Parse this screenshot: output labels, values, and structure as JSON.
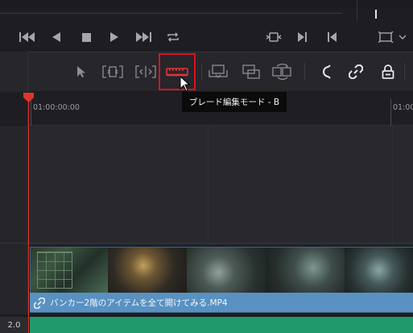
{
  "toolbar": {
    "tooltip": "ブレード編集モード - B"
  },
  "ruler": {
    "start_timecode": "01:00:00:00",
    "right_timecode": "01:00"
  },
  "clip": {
    "title": "バンカー2階のアイテムを全て開けてみる.MP4"
  },
  "tracks": {
    "audio_label": "2.0"
  },
  "colors": {
    "clip_label": "#5891c2",
    "audio_clip": "#1e9a6c",
    "playhead": "#e0342a",
    "highlight": "#d8141b"
  }
}
